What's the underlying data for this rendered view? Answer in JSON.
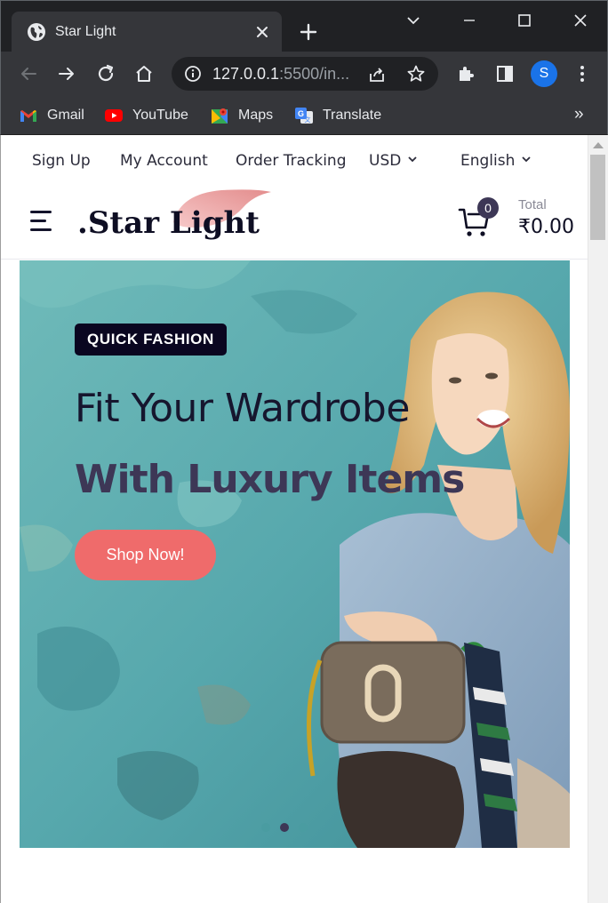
{
  "browser": {
    "tab_title": "Star Light",
    "url_host": "127.0.0.1",
    "url_rest": ":5500/in...",
    "profile_initial": "S",
    "bookmarks": [
      {
        "label": "Gmail",
        "icon": "gmail-icon"
      },
      {
        "label": "YouTube",
        "icon": "youtube-icon"
      },
      {
        "label": "Maps",
        "icon": "maps-icon"
      },
      {
        "label": "Translate",
        "icon": "translate-icon"
      }
    ],
    "bookmarks_more": "»"
  },
  "topnav": {
    "sign_up": "Sign Up",
    "my_account": "My Account",
    "order_tracking": "Order Tracking",
    "currency": "USD",
    "language": "English"
  },
  "header": {
    "logo": ".Star Light",
    "cart_count": "0",
    "total_label": "Total",
    "total_value": "₹0.00"
  },
  "hero": {
    "badge": "QUICK FASHION",
    "title_line1": "Fit Your Wardrobe",
    "title_line2": "With Luxury Items",
    "button": "Shop Now!",
    "slides": 3,
    "active_slide": 2
  },
  "colors": {
    "accent": "#ef6b6b",
    "brand_dark": "#3d3756",
    "badge_bg": "#0a0620",
    "hero_bg": "#5aa7ad"
  }
}
